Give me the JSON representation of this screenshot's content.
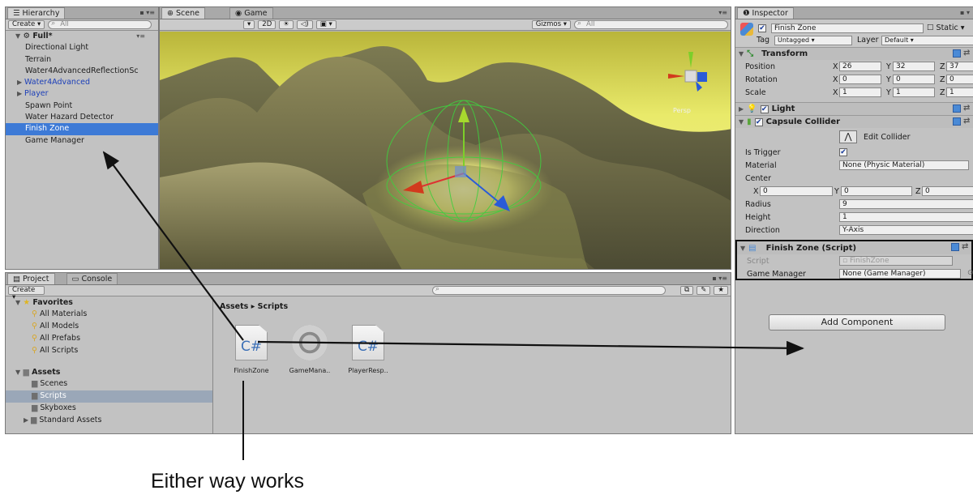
{
  "hierarchy": {
    "tab_label": "Hierarchy",
    "create_label": "Create",
    "search_placeholder": "All",
    "scene_name": "Full*",
    "items": [
      {
        "label": "Directional Light",
        "kind": "normal"
      },
      {
        "label": "Terrain",
        "kind": "normal"
      },
      {
        "label": "Water4AdvancedReflectionSc",
        "kind": "normal"
      },
      {
        "label": "Water4Advanced",
        "kind": "blue"
      },
      {
        "label": "Player",
        "kind": "blue"
      },
      {
        "label": "Spawn Point",
        "kind": "normal"
      },
      {
        "label": "Water Hazard Detector",
        "kind": "normal"
      },
      {
        "label": "Finish Zone",
        "kind": "selected"
      },
      {
        "label": "Game Manager",
        "kind": "normal"
      }
    ]
  },
  "scene_view": {
    "tab_scene": "Scene",
    "tab_game": "Game",
    "mode_2d": "2D",
    "gizmos_label": "Gizmos",
    "search_placeholder": "All",
    "persp_label": "Persp"
  },
  "project": {
    "tab_project": "Project",
    "tab_console": "Console",
    "create_label": "Create",
    "favorites_label": "Favorites",
    "favorites": [
      "All Materials",
      "All Models",
      "All Prefabs",
      "All Scripts"
    ],
    "assets_label": "Assets",
    "assets": [
      "Scenes",
      "Scripts",
      "Skyboxes",
      "Standard Assets"
    ],
    "selected_folder": "Scripts",
    "breadcrumb": "Assets ▸ Scripts",
    "files": [
      {
        "label": "FinishZone",
        "glyph": "C#"
      },
      {
        "label": "GameMana..",
        "glyph": "gear"
      },
      {
        "label": "PlayerResp..",
        "glyph": "C#"
      }
    ]
  },
  "inspector": {
    "tab_label": "Inspector",
    "object_name": "Finish Zone",
    "static_label": "Static",
    "tag_label": "Tag",
    "tag_value": "Untagged",
    "layer_label": "Layer",
    "layer_value": "Default",
    "transform": {
      "title": "Transform",
      "position_label": "Position",
      "position": {
        "x": "26",
        "y": "32",
        "z": "37"
      },
      "rotation_label": "Rotation",
      "rotation": {
        "x": "0",
        "y": "0",
        "z": "0"
      },
      "scale_label": "Scale",
      "scale": {
        "x": "1",
        "y": "1",
        "z": "1"
      }
    },
    "light_title": "Light",
    "capsule": {
      "title": "Capsule Collider",
      "edit_collider": "Edit Collider",
      "is_trigger_label": "Is Trigger",
      "material_label": "Material",
      "material_value": "None (Physic Material)",
      "center_label": "Center",
      "center": {
        "x": "0",
        "y": "0",
        "z": "0"
      },
      "radius_label": "Radius",
      "radius_value": "9",
      "height_label": "Height",
      "height_value": "1",
      "direction_label": "Direction",
      "direction_value": "Y-Axis"
    },
    "script_component": {
      "title": "Finish Zone (Script)",
      "script_label": "Script",
      "script_value": "FinishZone",
      "game_manager_label": "Game Manager",
      "game_manager_value": "None (Game Manager)"
    },
    "add_component_label": "Add Component"
  },
  "annotation": {
    "caption": "Either way works"
  }
}
